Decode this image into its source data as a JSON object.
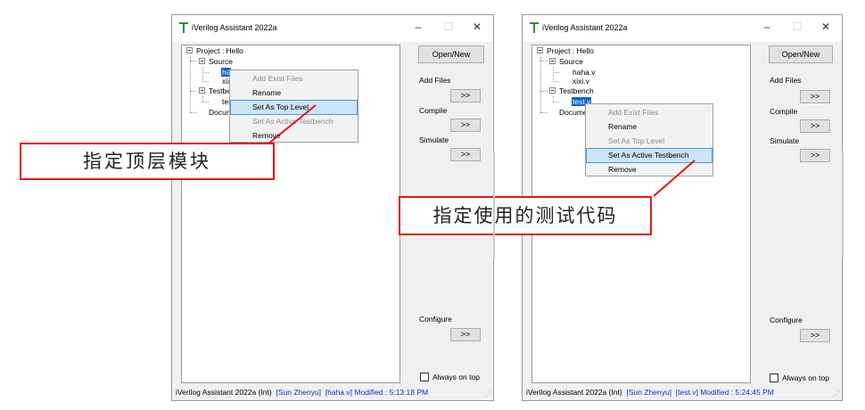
{
  "windows": [
    {
      "title": "iVerilog Assistant 2022a",
      "controls": {
        "minimize": "–",
        "maximize": "☐",
        "close": "✕"
      },
      "tree": {
        "project": "Project : Hello",
        "source": "Source",
        "source_files": [
          "ha",
          "xix"
        ],
        "testbench": "Testbe",
        "testbench_files": [
          "tes"
        ],
        "docs": "Docum"
      },
      "buttons": {
        "open_new": "Open/New",
        "add_files": ">>",
        "compile": ">>",
        "simulate": ">>",
        "configure": ">>"
      },
      "labels": {
        "add_files": "Add Files",
        "compile": "Compile",
        "simulate": "Simulate",
        "configure": "Configure"
      },
      "always_on_top": "Always on top",
      "context_menu": [
        {
          "label": "Add Exist Files",
          "enabled": false,
          "highlighted": false
        },
        {
          "label": "Rename",
          "enabled": true,
          "highlighted": false
        },
        {
          "label": "Set As Top Level",
          "enabled": true,
          "highlighted": true
        },
        {
          "label": "Set As Active Testbench",
          "enabled": false,
          "highlighted": false
        },
        {
          "label": "Remove",
          "enabled": true,
          "highlighted": false
        }
      ],
      "status": {
        "app": "iVerilog Assistant 2022a  (Int)",
        "user": "[Sun Zhenyu]",
        "file": "[haha.v]",
        "modified": "Modified : 5:13:18 PM"
      }
    },
    {
      "title": "iVerilog Assistant 2022a",
      "controls": {
        "minimize": "–",
        "maximize": "☐",
        "close": "✕"
      },
      "tree": {
        "project": "Project : Hello",
        "source": "Source",
        "source_files": [
          "haha.v",
          "xixi.v"
        ],
        "testbench": "Testbench",
        "testbench_files": [
          "test.v"
        ],
        "docs": "Docume"
      },
      "buttons": {
        "open_new": "Open/New",
        "add_files": ">>",
        "compile": ">>",
        "simulate": ">>",
        "configure": ">>"
      },
      "labels": {
        "add_files": "Add Files",
        "compile": "Compile",
        "simulate": "Simulate",
        "configure": "Configure"
      },
      "always_on_top": "Always on top",
      "context_menu": [
        {
          "label": "Add Exist Files",
          "enabled": false,
          "highlighted": false
        },
        {
          "label": "Rename",
          "enabled": true,
          "highlighted": false
        },
        {
          "label": "Set As Top Level",
          "enabled": false,
          "highlighted": false
        },
        {
          "label": "Set As Active Testbench",
          "enabled": true,
          "highlighted": true
        },
        {
          "label": "Remove",
          "enabled": true,
          "highlighted": false
        }
      ],
      "status": {
        "app": "iVerilog Assistant 2022a  (Int)",
        "user": "[Sun Zhenyu]",
        "file": "[test.v]",
        "modified": "Modified : 5:24:45 PM"
      }
    }
  ],
  "callouts": {
    "left": "指定顶层模块",
    "right": "指定使用的测试代码"
  },
  "colors": {
    "accent_red": "#e01818",
    "selection": "#0a64c8",
    "menu_highlight": "#cce4f7",
    "status_blue": "#1030d0"
  }
}
